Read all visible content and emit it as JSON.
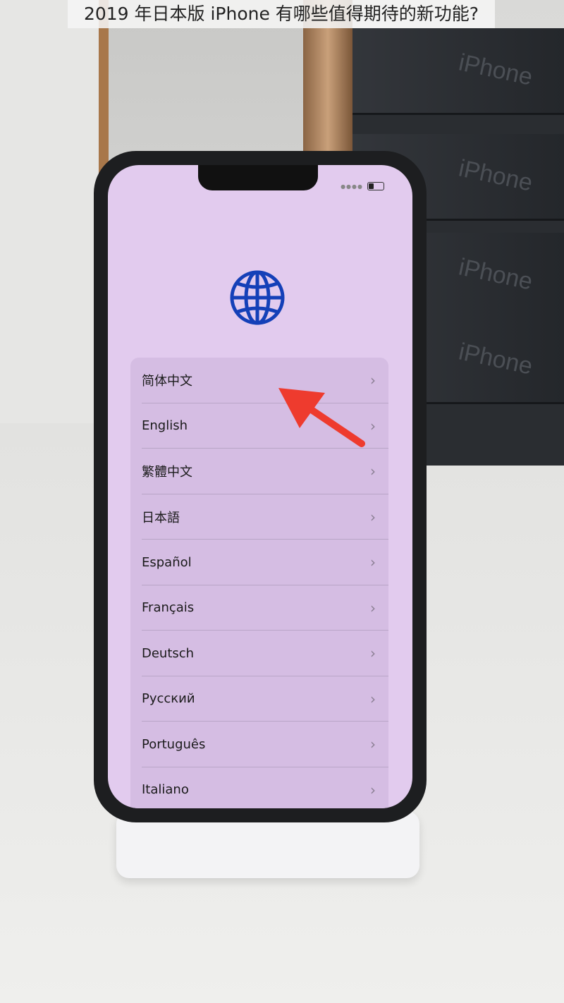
{
  "caption": "2019 年日本版 iPhone 有哪些值得期待的新功能?",
  "boxes": [
    "iPhone",
    "iPhone",
    "iPhone",
    "iPhone"
  ],
  "phone": {
    "icon": "globe-icon",
    "globe_color": "#1440b8",
    "languages": [
      "简体中文",
      "English",
      "繁體中文",
      "日本語",
      "Español",
      "Français",
      "Deutsch",
      "Русский",
      "Português",
      "Italiano"
    ],
    "chevron": "›"
  },
  "annotation": {
    "icon": "red-arrow-icon",
    "color": "#ee3b2e"
  }
}
